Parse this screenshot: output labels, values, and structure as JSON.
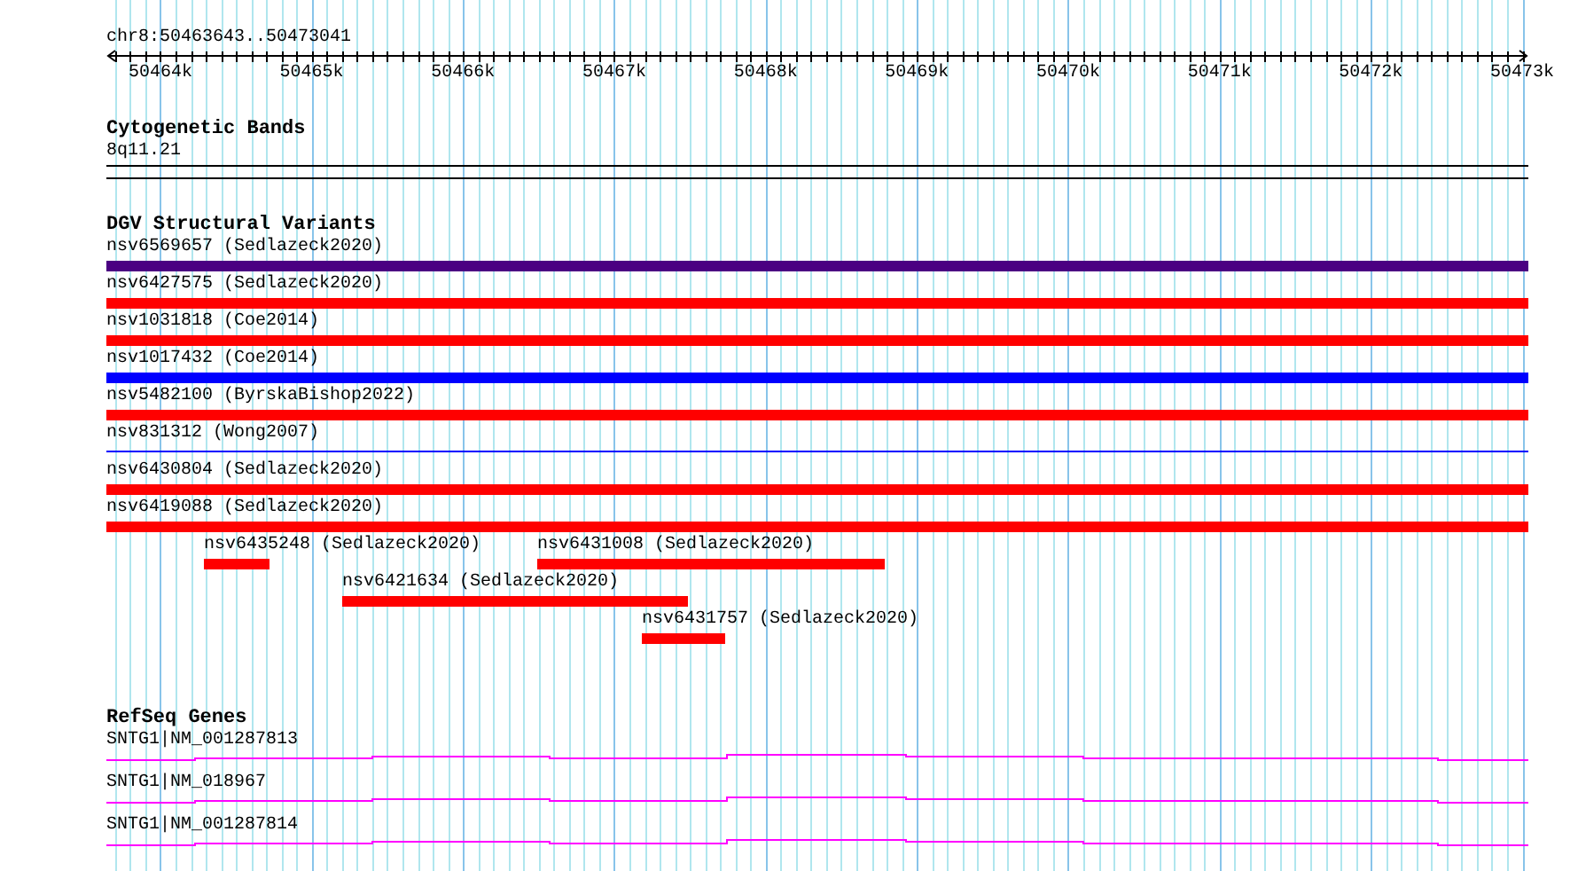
{
  "position": "chr8:50463643..50473041",
  "ruler": {
    "ticks": [
      "50464k",
      "50465k",
      "50466k",
      "50467k",
      "50468k",
      "50469k",
      "50470k",
      "50471k",
      "50472k",
      "50473k"
    ]
  },
  "cytogenetic_track": {
    "title": "Cytogenetic Bands",
    "bands": [
      "8q11.21"
    ]
  },
  "dgv_track": {
    "title": "DGV Structural Variants",
    "variants": [
      {
        "label": "nsv6569657 (Sedlazeck2020)",
        "color": "#4b0082",
        "kind": "bar"
      },
      {
        "label": "nsv6427575 (Sedlazeck2020)",
        "color": "#ff0000",
        "kind": "bar"
      },
      {
        "label": "nsv1031818 (Coe2014)",
        "color": "#ff0000",
        "kind": "bar"
      },
      {
        "label": "nsv1017432 (Coe2014)",
        "color": "#0000ff",
        "kind": "bar"
      },
      {
        "label": "nsv5482100 (ByrskaBishop2022)",
        "color": "#ff0000",
        "kind": "bar"
      },
      {
        "label": "nsv831312 (Wong2007)",
        "color": "#0000ff",
        "kind": "line"
      },
      {
        "label": "nsv6430804 (Sedlazeck2020)",
        "color": "#ff0000",
        "kind": "bar"
      },
      {
        "label": "nsv6419088 (Sedlazeck2020)",
        "color": "#ff0000",
        "kind": "bar"
      },
      {
        "label": "nsv6435248 (Sedlazeck2020)",
        "color": "#ff0000",
        "kind": "bar"
      },
      {
        "label": "nsv6431008 (Sedlazeck2020)",
        "color": "#ff0000",
        "kind": "bar"
      },
      {
        "label": "nsv6421634 (Sedlazeck2020)",
        "color": "#ff0000",
        "kind": "bar"
      },
      {
        "label": "nsv6431757 (Sedlazeck2020)",
        "color": "#ff0000",
        "kind": "bar"
      }
    ]
  },
  "refseq_track": {
    "title": "RefSeq Genes",
    "genes": [
      {
        "label": "SNTG1|NM_001287813"
      },
      {
        "label": "SNTG1|NM_018967"
      },
      {
        "label": "SNTG1|NM_001287814"
      }
    ]
  }
}
